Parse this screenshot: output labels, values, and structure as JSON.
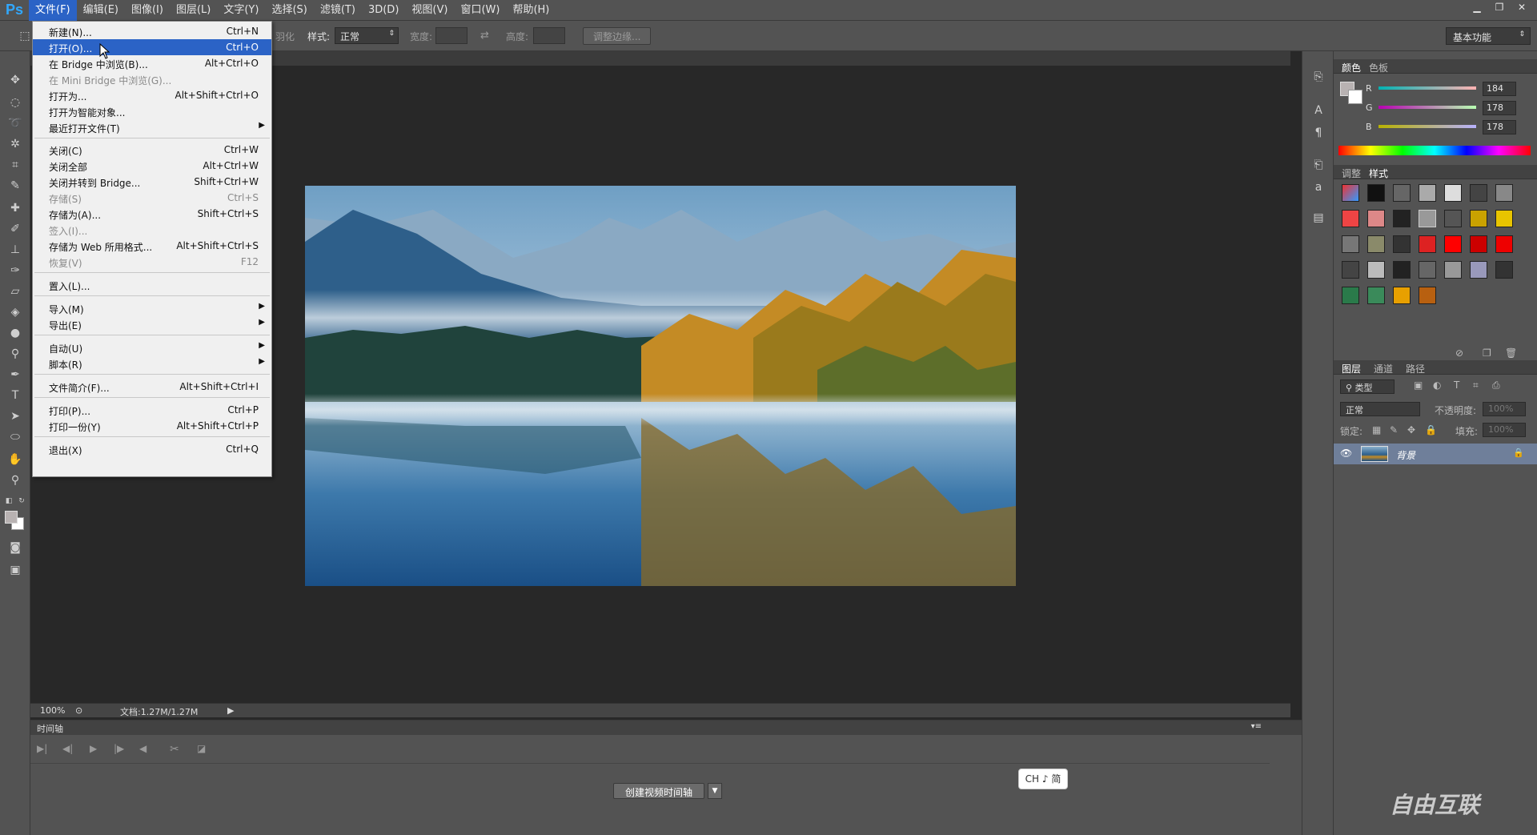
{
  "menubar": {
    "logo": "Ps",
    "items": [
      "文件(F)",
      "编辑(E)",
      "图像(I)",
      "图层(L)",
      "文字(Y)",
      "选择(S)",
      "滤镜(T)",
      "3D(D)",
      "视图(V)",
      "窗口(W)",
      "帮助(H)"
    ]
  },
  "optionsbar": {
    "feather_partial": "羽化",
    "style_label": "样式:",
    "style_value": "正常",
    "width_label": "宽度:",
    "height_label": "高度:",
    "refine_edge": "调整边缘...",
    "workspace": "基本功能"
  },
  "file_menu": {
    "items": [
      {
        "label": "新建(N)...",
        "shortcut": "Ctrl+N"
      },
      {
        "label": "打开(O)...",
        "shortcut": "Ctrl+O"
      },
      {
        "label": "在 Bridge 中浏览(B)...",
        "shortcut": "Alt+Ctrl+O"
      },
      {
        "label": "在 Mini Bridge 中浏览(G)...",
        "shortcut": ""
      },
      {
        "label": "打开为...",
        "shortcut": "Alt+Shift+Ctrl+O"
      },
      {
        "label": "打开为智能对象...",
        "shortcut": ""
      },
      {
        "label": "最近打开文件(T)",
        "shortcut": ""
      },
      {
        "label": "关闭(C)",
        "shortcut": "Ctrl+W"
      },
      {
        "label": "关闭全部",
        "shortcut": "Alt+Ctrl+W"
      },
      {
        "label": "关闭并转到 Bridge...",
        "shortcut": "Shift+Ctrl+W"
      },
      {
        "label": "存储(S)",
        "shortcut": "Ctrl+S"
      },
      {
        "label": "存储为(A)...",
        "shortcut": "Shift+Ctrl+S"
      },
      {
        "label": "签入(I)...",
        "shortcut": ""
      },
      {
        "label": "存储为 Web 所用格式...",
        "shortcut": "Alt+Shift+Ctrl+S"
      },
      {
        "label": "恢复(V)",
        "shortcut": "F12"
      },
      {
        "label": "置入(L)...",
        "shortcut": ""
      },
      {
        "label": "导入(M)",
        "shortcut": ""
      },
      {
        "label": "导出(E)",
        "shortcut": ""
      },
      {
        "label": "自动(U)",
        "shortcut": ""
      },
      {
        "label": "脚本(R)",
        "shortcut": ""
      },
      {
        "label": "文件简介(F)...",
        "shortcut": "Alt+Shift+Ctrl+I"
      },
      {
        "label": "打印(P)...",
        "shortcut": "Ctrl+P"
      },
      {
        "label": "打印一份(Y)",
        "shortcut": "Alt+Shift+Ctrl+P"
      },
      {
        "label": "退出(X)",
        "shortcut": "Ctrl+Q"
      }
    ]
  },
  "status": {
    "zoom": "100%",
    "doc_info": "文档:1.27M/1.27M"
  },
  "timeline": {
    "title": "时间轴",
    "create_button": "创建视频时间轴",
    "ime": "CH ♪ 简"
  },
  "color_panel": {
    "tabs": [
      "颜色",
      "色板"
    ],
    "r_label": "R",
    "r_value": "184",
    "g_label": "G",
    "g_value": "178",
    "b_label": "B",
    "b_value": "178",
    "foreground": "#b8b2b2"
  },
  "styles_panel": {
    "tabs": [
      "调整",
      "样式"
    ]
  },
  "layers_panel": {
    "tabs": [
      "图层",
      "通道",
      "路径"
    ],
    "kind_filter": "类型",
    "blend_mode": "正常",
    "opacity_label": "不透明度:",
    "opacity_value": "100%",
    "lock_label": "锁定:",
    "fill_label": "填充:",
    "fill_value": "100%",
    "layer_name": "背景"
  },
  "watermark": "自由互联"
}
